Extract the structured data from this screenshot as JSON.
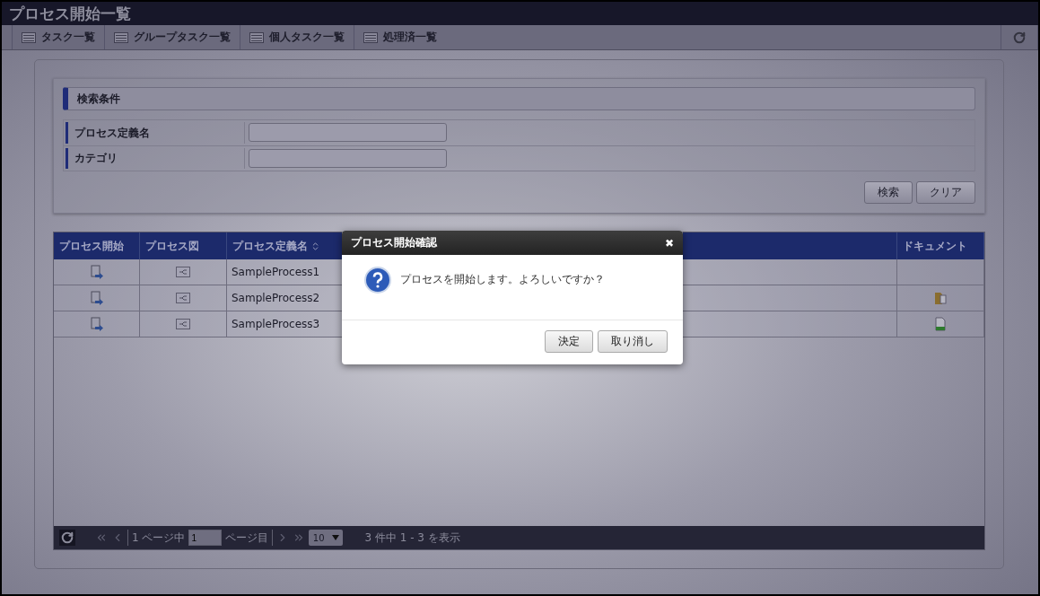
{
  "window": {
    "title": "プロセス開始一覧"
  },
  "tabs": [
    {
      "label": "タスク一覧"
    },
    {
      "label": "グループタスク一覧"
    },
    {
      "label": "個人タスク一覧"
    },
    {
      "label": "処理済一覧"
    }
  ],
  "search": {
    "title": "検索条件",
    "fields": [
      {
        "label": "プロセス定義名"
      },
      {
        "label": "カテゴリ"
      }
    ],
    "buttons": [
      "検索",
      "クリア"
    ]
  },
  "table": {
    "columns": [
      "プロセス開始",
      "プロセス図",
      "プロセス定義名",
      "ドキュメント"
    ],
    "rows": [
      {
        "name": "SampleProcess1"
      },
      {
        "name": "SampleProcess2",
        "kind": "folder"
      },
      {
        "name": "SampleProcess3",
        "kind": "sheet"
      }
    ]
  },
  "pager": {
    "before": "1 ページ中",
    "page": "1",
    "after": "ページ目",
    "per_page": "10",
    "summary": "3 件中 1 - 3 を表示"
  },
  "dialog": {
    "title": "プロセス開始確認",
    "close": "✖",
    "message": "プロセスを開始します。よろしいですか？",
    "buttons": [
      "決定",
      "取り消し"
    ]
  }
}
